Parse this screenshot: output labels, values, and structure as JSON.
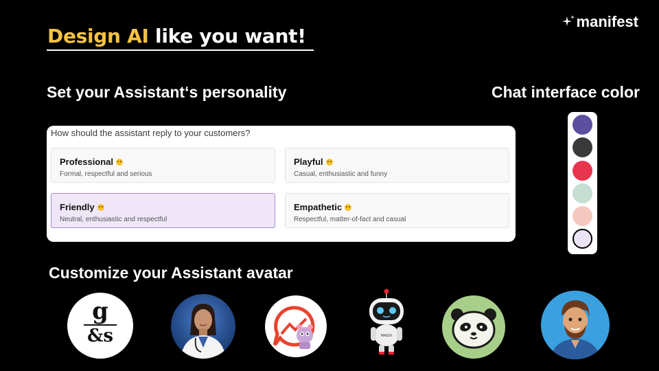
{
  "header": {
    "headline_accent": "Design AI",
    "headline_rest": " like you want!",
    "logo_text": "manifest"
  },
  "personality": {
    "title": "Set your Assistant‘s personality",
    "question": "How should the assistant reply to your customers?",
    "options": [
      {
        "title": "Professional",
        "description": "Formal, respectful and serious",
        "selected": false
      },
      {
        "title": "Playful",
        "description": "Casual, enthusiastic and funny",
        "selected": false
      },
      {
        "title": "Friendly",
        "description": "Neutral, enthusiastic and respectful",
        "selected": true
      },
      {
        "title": "Empathetic",
        "description": "Respectful, matter-of-fact and casual",
        "selected": false
      }
    ]
  },
  "chat_color": {
    "title": "Chat interface color",
    "swatches": [
      {
        "name": "indigo",
        "color": "#5b4f9e",
        "selected": false
      },
      {
        "name": "charcoal",
        "color": "#3a3a3a",
        "selected": false
      },
      {
        "name": "red-pink",
        "color": "#e8344f",
        "selected": false
      },
      {
        "name": "mint",
        "color": "#c5dfd4",
        "selected": false
      },
      {
        "name": "peach",
        "color": "#f4c7bf",
        "selected": false
      },
      {
        "name": "lavender",
        "color": "#ebe4f4",
        "selected": true
      }
    ]
  },
  "avatar": {
    "title": "Customize your Assistant avatar",
    "items": [
      {
        "name": "avatar-gs-logo",
        "logo_text_top": "g",
        "logo_text_bottom": "&s"
      },
      {
        "name": "avatar-doctor"
      },
      {
        "name": "avatar-chat-robot"
      },
      {
        "name": "avatar-robot",
        "badge_text": "MAGIX"
      },
      {
        "name": "avatar-panda"
      },
      {
        "name": "avatar-cartoon-man"
      }
    ]
  }
}
